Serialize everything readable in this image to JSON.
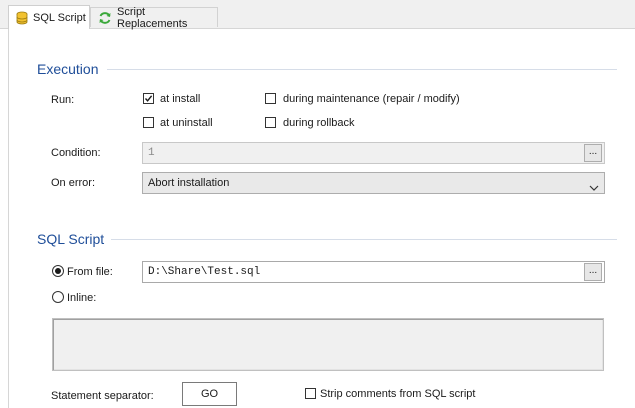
{
  "tabs": [
    {
      "label": "SQL Script",
      "icon": "database-icon",
      "active": true
    },
    {
      "label": "Script Replacements",
      "icon": "refresh-icon",
      "active": false
    }
  ],
  "execution": {
    "title": "Execution",
    "run_label": "Run:",
    "options": [
      {
        "label": "at install",
        "checked": true
      },
      {
        "label": "during maintenance (repair / modify)",
        "checked": false
      },
      {
        "label": "at uninstall",
        "checked": false
      },
      {
        "label": "during rollback",
        "checked": false
      }
    ],
    "condition_label": "Condition:",
    "condition_value": "1",
    "on_error_label": "On error:",
    "on_error_value": "Abort installation"
  },
  "sql_script": {
    "title": "SQL Script",
    "from_file_label": "From file:",
    "from_file_value": "D:\\Share\\Test.sql",
    "inline_label": "Inline:",
    "selected_source": "from_file",
    "separator_label": "Statement separator:",
    "separator_value": "GO",
    "strip_comments_label": "Strip comments from SQL script",
    "strip_comments_checked": false
  },
  "browse_button_label": "...",
  "colors": {
    "section_title": "#1f4e99",
    "tab_background": "#f0f0f0"
  }
}
